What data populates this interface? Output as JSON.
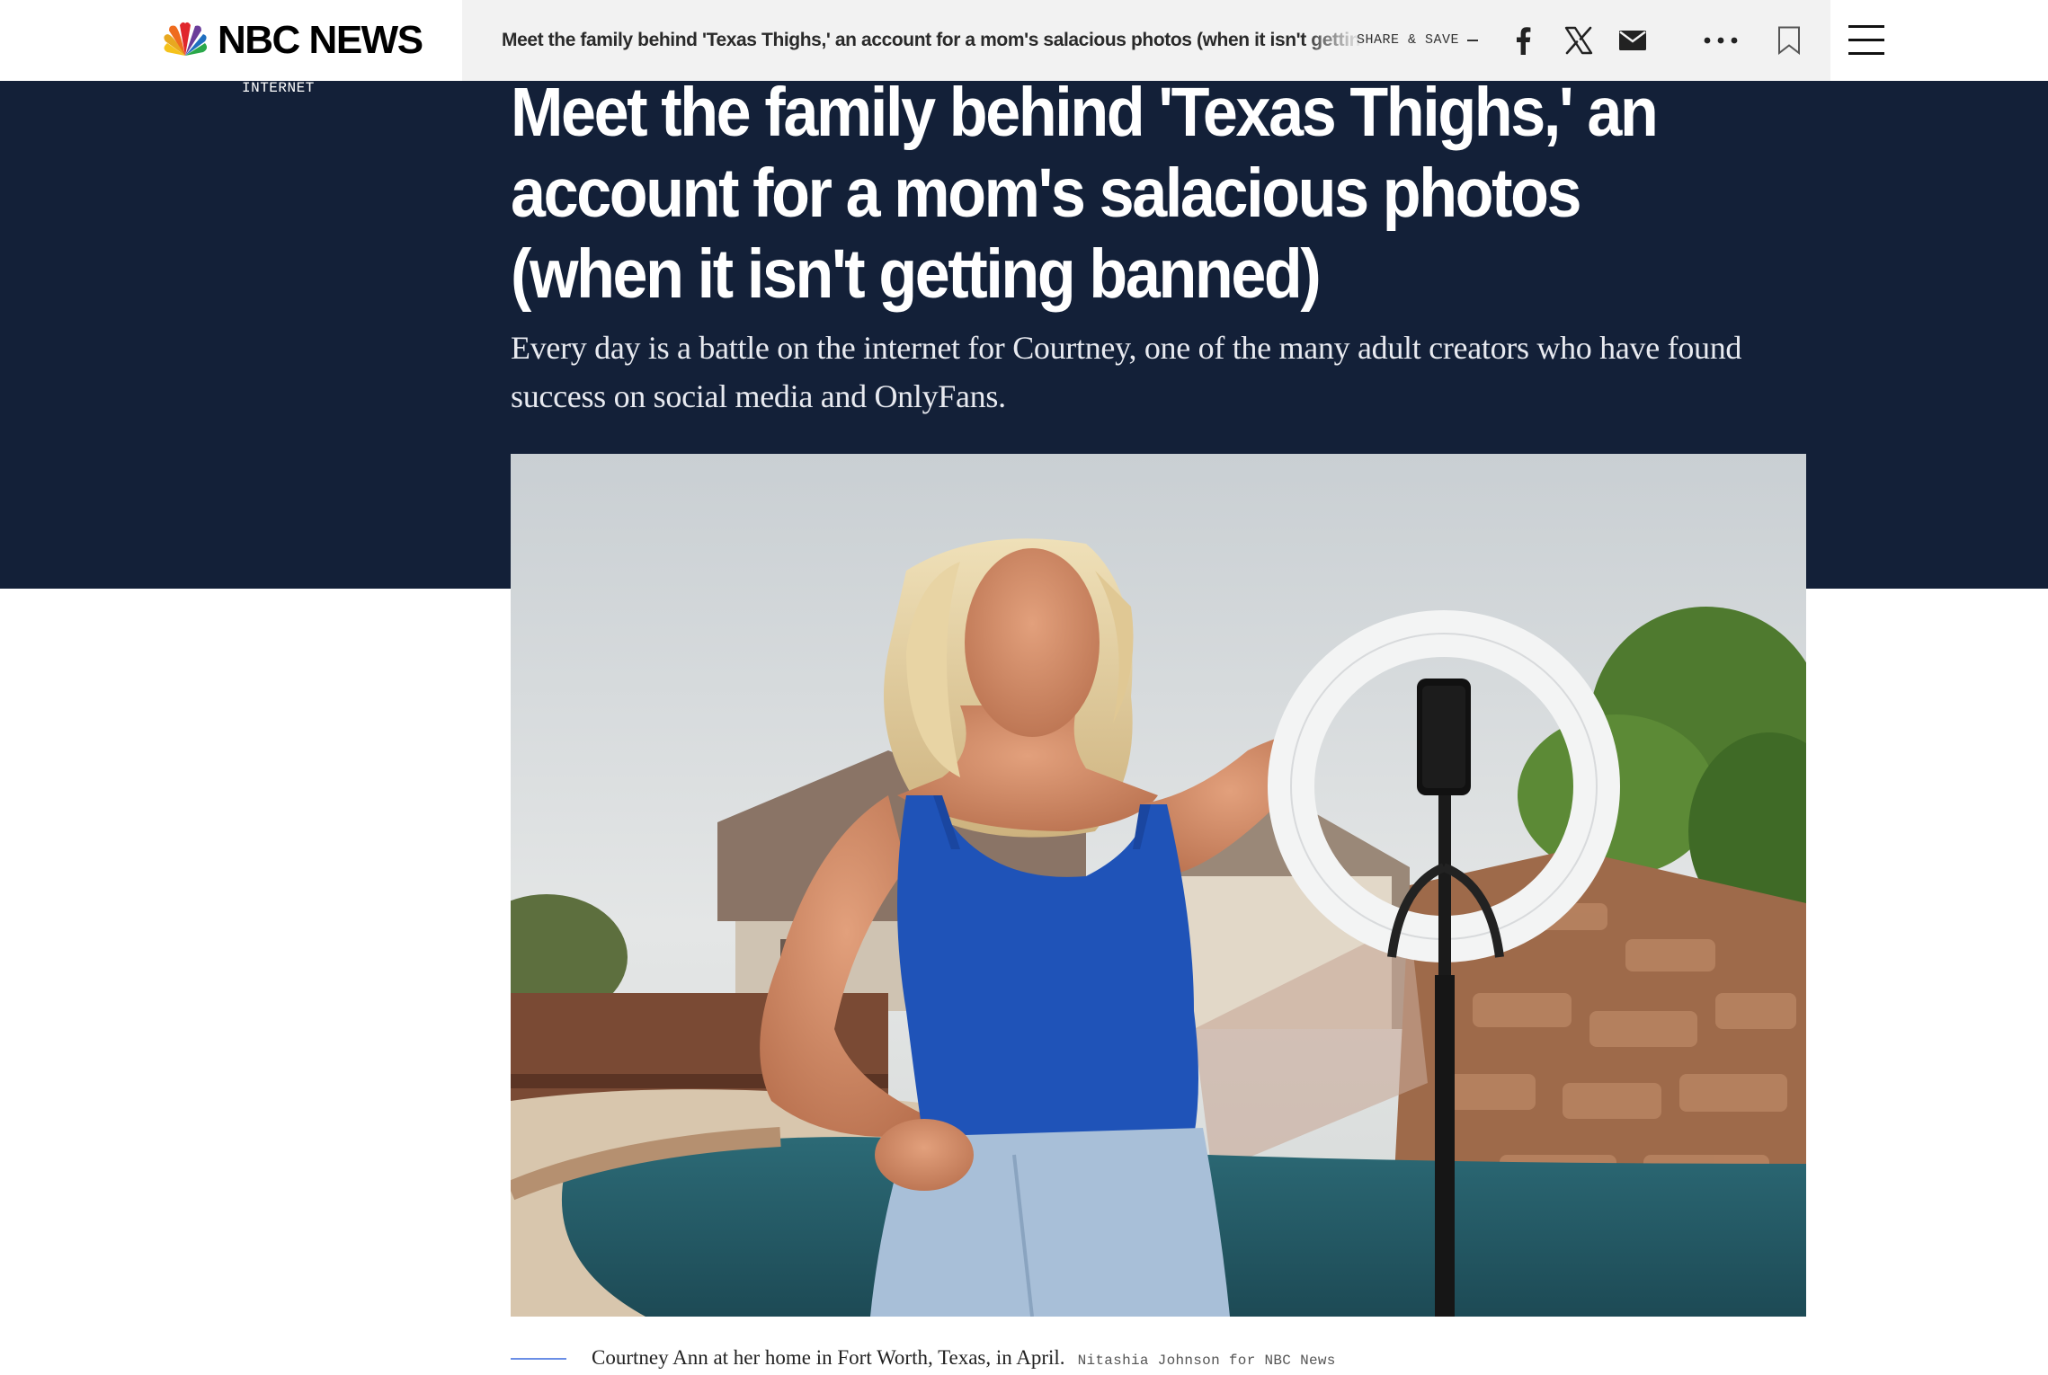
{
  "header": {
    "logo_text": "NBC NEWS",
    "sticky_headline": "Meet the family behind 'Texas Thighs,' an account for a mom's salacious photos (when it isn't getting banned)",
    "share_label": "SHARE & SAVE",
    "icons": [
      "peacock-logo-icon",
      "facebook-icon",
      "x-icon",
      "mail-icon",
      "more-icon",
      "bookmark-icon",
      "hamburger-menu-icon"
    ]
  },
  "article": {
    "section": "INTERNET",
    "headline": "Meet the family behind 'Texas Thighs,' an account for a mom's salacious photos (when it isn't getting banned)",
    "dek": "Every day is a battle on the internet for Courtney, one of the many adult creators who have found success on social media and OnlyFans.",
    "image": {
      "caption": "Courtney Ann at her home in Fort Worth, Texas, in April.",
      "credit": "Nitashia Johnson for NBC News"
    }
  },
  "colors": {
    "hero_background": "#132038",
    "share_strip": "#f2f2f2",
    "caption_rule": "#6b8ee6"
  }
}
